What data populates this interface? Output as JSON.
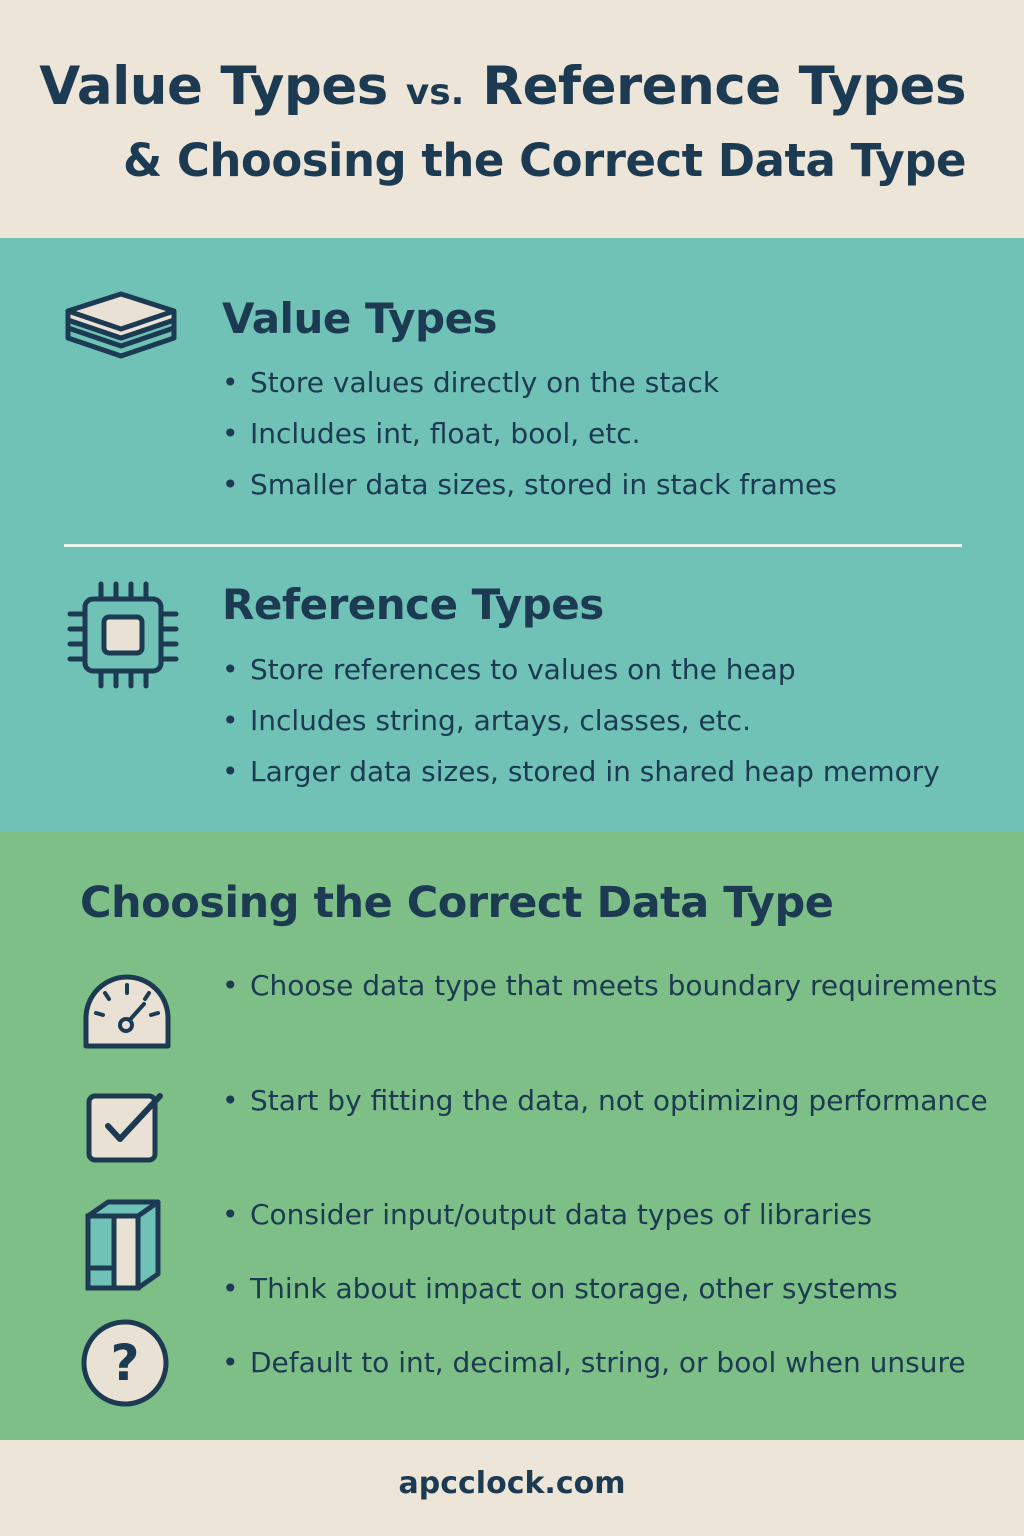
{
  "header": {
    "title_part1": "Value Types ",
    "title_vs": "vs.",
    "title_part2": " Reference Types",
    "subtitle": "& Choosing the Correct Data Type"
  },
  "value_types": {
    "icon": "layers-icon",
    "heading": "Value Types",
    "bullets": [
      "Store values directly on the stack",
      "Includes int, float, bool, etc.",
      "Smaller data sizes, stored in stack frames"
    ]
  },
  "reference_types": {
    "icon": "chip-icon",
    "heading": "Reference Types",
    "bullets": [
      "Store references to values on the heap",
      "Includes string, artays, classes, etc.",
      "Larger data sizes, stored in shared heap memory"
    ]
  },
  "choosing": {
    "heading": "Choosing the Correct Data Type",
    "tips": [
      {
        "icon": "gauge-icon",
        "text": "Choose data type that meets boundary requirements"
      },
      {
        "icon": "checkbox-icon",
        "text": "Start by fitting the data, not optimizing performance"
      },
      {
        "icon": "books-icon",
        "text": "Consider input/output data types of libraries"
      },
      {
        "icon": "",
        "text": "Think about impact on storage, other systems"
      },
      {
        "icon": "question-icon",
        "text": "Default to int, decimal, string, or bool when unsure"
      }
    ]
  },
  "footer": {
    "site": "apcclock.com"
  },
  "colors": {
    "navy": "#1c3a52",
    "cream": "#ede5d8",
    "teal": "#70c1b6",
    "green": "#7dbf86",
    "icon_fill": "#e9e2d4"
  }
}
